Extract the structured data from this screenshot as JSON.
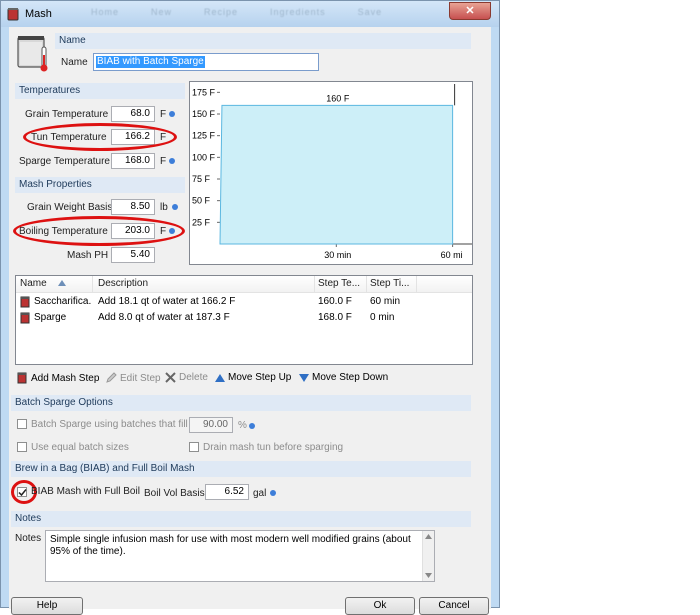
{
  "window": {
    "title": "Mash",
    "close_glyph": "✕",
    "ghost_menu": [
      "Home",
      "New",
      "Recipe",
      "Ingredients",
      "Save"
    ]
  },
  "name_section": {
    "header": "Name",
    "label": "Name",
    "value": "BIAB with Batch Sparge"
  },
  "temperatures": {
    "header": "Temperatures",
    "grain_label": "Grain Temperature",
    "grain_value": "68.0",
    "grain_unit": "F",
    "tun_label": "Tun Temperature",
    "tun_value": "166.2",
    "tun_unit": "F",
    "sparge_label": "Sparge Temperature",
    "sparge_value": "168.0",
    "sparge_unit": "F"
  },
  "mash_properties": {
    "header": "Mash Properties",
    "grain_weight_label": "Grain Weight Basis",
    "grain_weight_value": "8.50",
    "grain_weight_unit": "lb",
    "boiling_label": "Boiling Temperature",
    "boiling_value": "203.0",
    "boiling_unit": "F",
    "ph_label": "Mash PH",
    "ph_value": "5.40"
  },
  "chart_data": {
    "type": "area",
    "y_ticks": [
      "175 F",
      "150 F",
      "125 F",
      "100 F",
      "75 F",
      "50 F",
      "25 F"
    ],
    "y_values": [
      175,
      150,
      125,
      100,
      75,
      50,
      25
    ],
    "x_ticks": [
      "30 min",
      "60 mi"
    ],
    "x_values": [
      30,
      60
    ],
    "annotation": "160 F",
    "ylim": [
      0,
      180
    ],
    "xlim": [
      0,
      65
    ],
    "series": [
      {
        "points": [
          [
            0,
            0
          ],
          [
            0.5,
            160
          ],
          [
            60,
            160
          ],
          [
            60,
            0
          ]
        ]
      }
    ],
    "fill": "#cdeff8",
    "stroke": "#5bb7e0"
  },
  "steps_table": {
    "columns": [
      "Name",
      "Description",
      "Step Te...",
      "Step Ti..."
    ],
    "rows": [
      {
        "name": "Saccharifica...",
        "description": "Add 18.1 qt of water at 166.2 F",
        "temp": "160.0 F",
        "time": "60 min"
      },
      {
        "name": "Sparge",
        "description": "Add 8.0 qt of water at 187.3 F",
        "temp": "168.0 F",
        "time": "0 min"
      }
    ]
  },
  "toolbar": {
    "add": "Add Mash Step",
    "edit": "Edit Step",
    "delete": "Delete",
    "up": "Move Step Up",
    "down": "Move Step Down"
  },
  "batch_sparge": {
    "header": "Batch Sparge Options",
    "using_batches_label": "Batch Sparge using batches that fill",
    "using_batches_value": "90.00",
    "using_batches_unit": "%",
    "equal_batch_label": "Use equal batch sizes",
    "drain_label": "Drain mash tun before sparging"
  },
  "biab": {
    "header": "Brew in a Bag (BIAB) and Full Boil Mash",
    "full_boil_label": "BIAB Mash with Full Boil",
    "full_boil_checked": true,
    "boil_vol_label": "Boil Vol Basis",
    "boil_vol_value": "6.52",
    "boil_vol_unit": "gal"
  },
  "notes": {
    "header": "Notes",
    "label": "Notes",
    "text": "Simple single infusion mash for use with most modern well modified grains (about 95% of the time)."
  },
  "footer": {
    "help": "Help",
    "ok": "Ok",
    "cancel": "Cancel"
  },
  "colors": {
    "accent_dot": "#3d7ed9",
    "annotation_ring": "#dd1111",
    "section_header": "#dfe9f5"
  }
}
